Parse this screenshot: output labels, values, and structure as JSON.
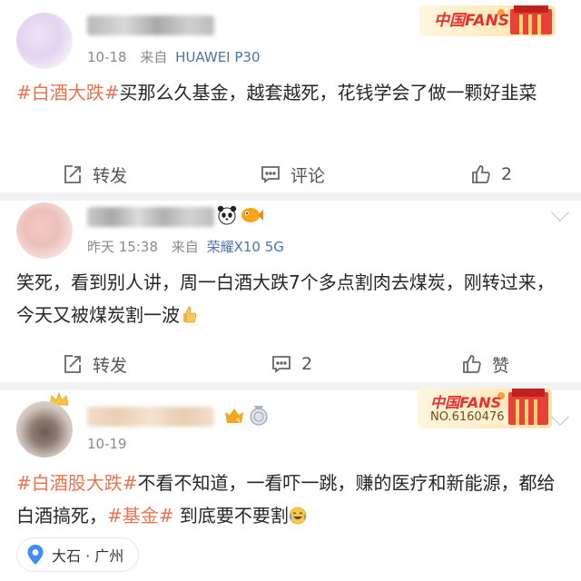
{
  "posts": [
    {
      "date": "10-18",
      "from_label": "来自",
      "device": "HUAWEI P30",
      "content": {
        "tag": "#白酒大跌#",
        "text": "买那么久基金，越套越死，花钱学会了做一颗好韭菜"
      },
      "badge": {
        "text": "中国FANS"
      },
      "actions": {
        "repost": "转发",
        "comment": "评论",
        "like": "2"
      }
    },
    {
      "date": "昨天 15:38",
      "from_label": "来自",
      "device": "荣耀X10 5G",
      "content": {
        "text": "笑死，看到别人讲，周一白酒大跌7个多点割肉去煤炭，刚转过来，今天又被煤炭割一波"
      },
      "actions": {
        "repost": "转发",
        "comment": "2",
        "like": "赞"
      }
    },
    {
      "date": "10-19",
      "content": {
        "tag1": "#白酒股大跌#",
        "text1": "不看不知道，一看吓一跳，赚的医疗和新能源，都给白酒搞死，",
        "tag2": "#基金#",
        "text2": " 到底要不要割"
      },
      "badge": {
        "text": "中国FANS",
        "number": "NO.6160476"
      },
      "location": "大石 · 广州"
    }
  ],
  "colors": {
    "accent": "#eb7350",
    "link": "#4e73a8",
    "meta": "#8a8a8a",
    "divider": "#f2f2f2"
  },
  "icons": [
    "repost-icon",
    "comment-icon",
    "thumb-up-icon",
    "location-pin-icon",
    "chevron-down-icon",
    "panda-emoji-icon",
    "fish-emoji-icon",
    "crown-icon",
    "level-badge-icon",
    "medal-icon",
    "thumbs-up-emoji-icon",
    "laugh-cry-emoji-icon"
  ]
}
